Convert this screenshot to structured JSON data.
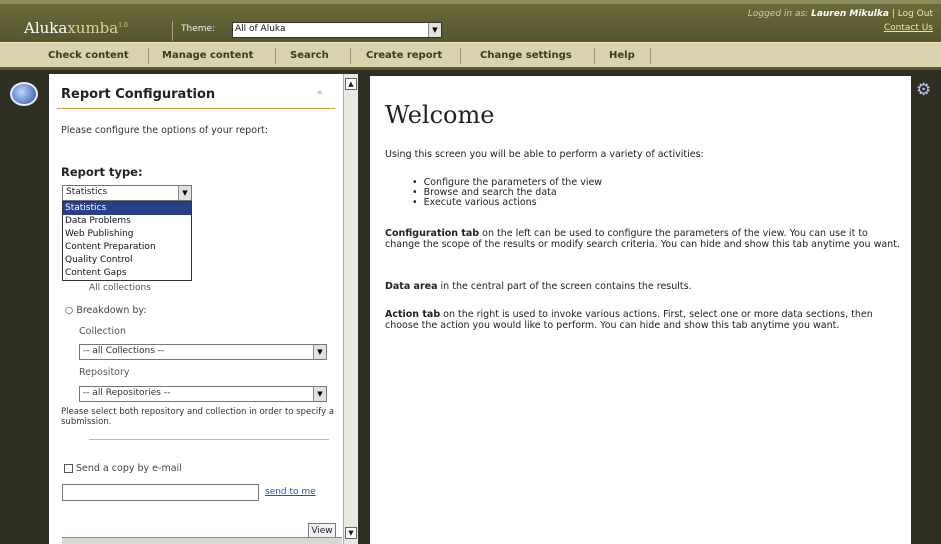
{
  "header": {
    "logo_main": "Aluka",
    "logo_sub": "xumba",
    "logo_version": "1.0",
    "theme_label": "Theme:",
    "theme_value": "All of Aluka",
    "login_prefix": "Logged in as:",
    "login_user": "Lauren Mikulka",
    "logout": "| Log Out",
    "contact": "Contact Us"
  },
  "nav": {
    "items": [
      "Check content",
      "Manage content",
      "Search",
      "Create report",
      "Change settings",
      "Help"
    ]
  },
  "config": {
    "title": "Report Configuration",
    "collapse_icon": "«",
    "intro": "Please configure the options of your report:",
    "report_type_label": "Report type:",
    "report_type_value": "Statistics",
    "report_type_options": [
      "Statistics",
      "Data Problems",
      "Web Publishing",
      "Content Preparation",
      "Quality Control",
      "Content Gaps"
    ],
    "hidden_option": "All collections",
    "breakdown_label": "Breakdown by:",
    "collection_label": "Collection",
    "collection_value": "-- all Collections --",
    "repository_label": "Repository",
    "repository_value": "-- all Repositories --",
    "help_text": "Please select both repository and collection in order to specify a submission.",
    "email_label": "Send a copy by e-mail",
    "send_link": "send to me",
    "view_button": "View"
  },
  "main": {
    "heading": "Welcome",
    "intro": "Using this screen you will be able to perform a variety of activities:",
    "bullets": [
      "Configure the parameters of the view",
      "Browse and search the data",
      "Execute various actions"
    ],
    "config_tab_bold": "Configuration tab",
    "config_tab_text": " on the left can be used to configure the parameters of the view. You can use it to change the scope of the results or modify search criteria. You can hide and show this tab anytime you want.",
    "data_area_bold": "Data area",
    "data_area_text": " in the central part of the screen contains the results.",
    "action_tab_bold": "Action tab",
    "action_tab_text": " on the right is used to invoke various actions. First, select one or more data sections, then choose the action you would like to perform. You can hide and show this tab anytime you want."
  }
}
